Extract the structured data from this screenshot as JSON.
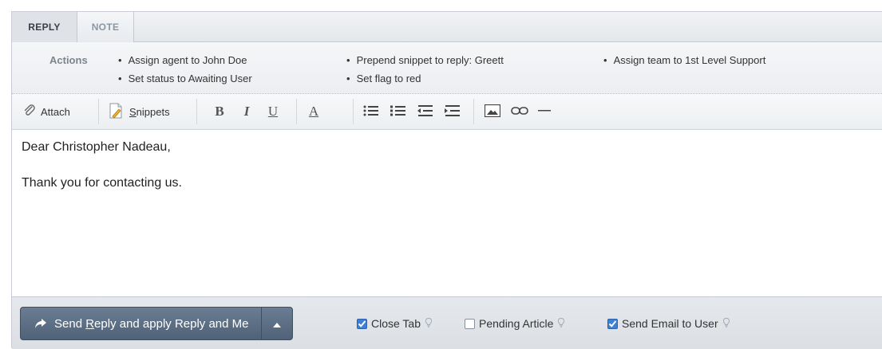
{
  "tabs": [
    {
      "label": "REPLY",
      "active": true
    },
    {
      "label": "NOTE",
      "active": false
    }
  ],
  "actions": {
    "label": "Actions",
    "items": [
      "Assign agent to John Doe",
      "Set status to Awaiting User",
      "Prepend snippet to reply: Greett",
      "Set flag to red",
      "Assign team to 1st Level Support"
    ]
  },
  "toolbar": {
    "attach_label": "Attach",
    "snippets_prefix": "S",
    "snippets_rest": "nippets",
    "bold": "B",
    "italic": "I",
    "underline": "U",
    "font_color": "A"
  },
  "editor": {
    "line1": "Dear Christopher Nadeau,",
    "line2": "Thank you for contacting us."
  },
  "footer": {
    "send_pre": "Send ",
    "send_underlined": "R",
    "send_post": "eply and apply Reply and Me",
    "options": [
      {
        "label": "Close Tab",
        "checked": true
      },
      {
        "label": "Pending Article",
        "checked": false
      },
      {
        "label": "Send Email to User",
        "checked": true
      }
    ]
  },
  "colors": {
    "send_button": "#5a6d82",
    "checkbox_checked": "#3f7fd6",
    "actions_label": "#7c848d"
  }
}
